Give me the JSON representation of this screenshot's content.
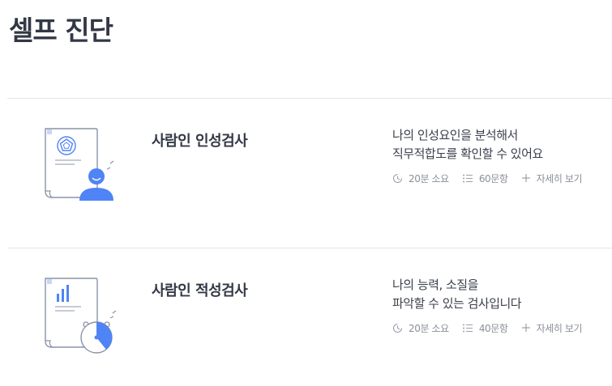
{
  "page_title": "셀프 진단",
  "items": [
    {
      "title": "사람인 인성검사",
      "desc_line1": "나의 인성요인을 분석해서",
      "desc_line2": "직무적합도를 확인할 수 있어요",
      "time": "20분 소요",
      "questions": "60문항",
      "detail": "자세히 보기"
    },
    {
      "title": "사람인 적성검사",
      "desc_line1": "나의 능력, 소질을",
      "desc_line2": "파악할 수 있는 검사입니다",
      "time": "20분 소요",
      "questions": "40문항",
      "detail": "자세히 보기"
    }
  ],
  "colors": {
    "accent": "#4f84f6",
    "line": "#8a93a8",
    "text": "#333845",
    "meta": "#8a8f99",
    "divider": "#e2e4e8"
  },
  "icons": [
    "personality-test-icon",
    "aptitude-test-icon",
    "clock-icon",
    "list-icon",
    "plus-icon"
  ]
}
